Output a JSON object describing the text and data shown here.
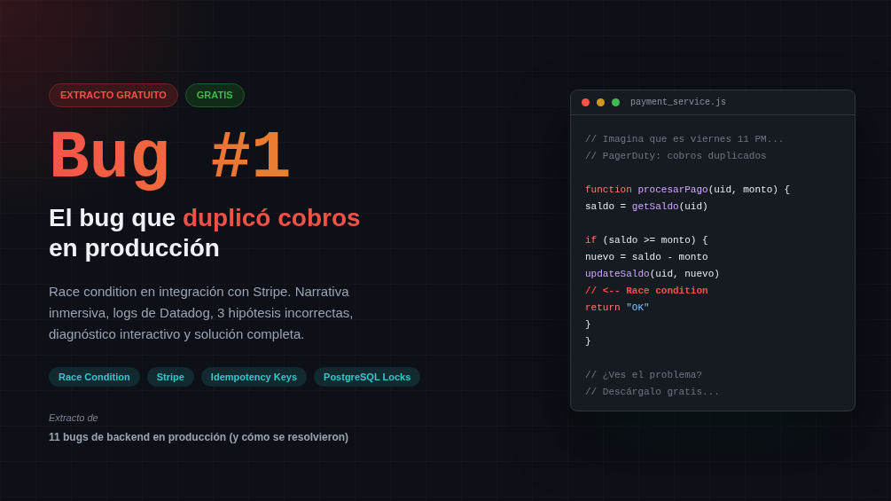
{
  "badges": [
    {
      "label": "EXTRACTO GRATUITO",
      "kind": "red"
    },
    {
      "label": "GRATIS",
      "kind": "green"
    }
  ],
  "title": "Bug #1",
  "headline": {
    "before": "El bug que ",
    "highlight": "duplicó cobros",
    "after": "en producción"
  },
  "description": "Race condition en integración con Stripe. Narrativa inmersiva, logs de Datadog, 3 hipótesis incorrectas, diagnóstico interactivo y solución completa.",
  "tags": [
    "Race Condition",
    "Stripe",
    "Idempotency Keys",
    "PostgreSQL Locks"
  ],
  "source": {
    "label": "Extracto de",
    "book": "11 bugs de backend en producción (y cómo se resolvieron)"
  },
  "editor": {
    "filename": "payment_service.js",
    "lines": [
      {
        "kind": "code",
        "tokens": [
          {
            "kind": "comment",
            "text": "// Imagina que es viernes 11 PM..."
          }
        ]
      },
      {
        "kind": "code",
        "tokens": [
          {
            "kind": "comment",
            "text": "// PagerDuty: cobros duplicados"
          }
        ]
      },
      {
        "kind": "blank"
      },
      {
        "kind": "code",
        "tokens": [
          {
            "kind": "keyword",
            "text": "function "
          },
          {
            "kind": "function",
            "text": "procesarPago"
          },
          {
            "kind": "plain",
            "text": "(uid, monto) {"
          }
        ]
      },
      {
        "kind": "code",
        "tokens": [
          {
            "kind": "plain",
            "text": "saldo = "
          },
          {
            "kind": "function",
            "text": "getSaldo"
          },
          {
            "kind": "plain",
            "text": "(uid)"
          }
        ]
      },
      {
        "kind": "blank"
      },
      {
        "kind": "code",
        "tokens": [
          {
            "kind": "keyword",
            "text": "if"
          },
          {
            "kind": "plain",
            "text": " (saldo >= monto) {"
          }
        ]
      },
      {
        "kind": "code",
        "tokens": [
          {
            "kind": "plain",
            "text": "nuevo = saldo - monto"
          }
        ]
      },
      {
        "kind": "code",
        "tokens": [
          {
            "kind": "function",
            "text": "updateSaldo"
          },
          {
            "kind": "plain",
            "text": "(uid, nuevo)"
          }
        ]
      },
      {
        "kind": "code",
        "tokens": [
          {
            "kind": "alert",
            "text": "// <-- Race condition"
          }
        ]
      },
      {
        "kind": "code",
        "tokens": [
          {
            "kind": "keyword",
            "text": "return "
          },
          {
            "kind": "string",
            "text": "\"OK\""
          }
        ]
      },
      {
        "kind": "code",
        "tokens": [
          {
            "kind": "plain",
            "text": "}"
          }
        ]
      },
      {
        "kind": "code",
        "tokens": [
          {
            "kind": "plain",
            "text": "}"
          }
        ]
      },
      {
        "kind": "blank"
      },
      {
        "kind": "code",
        "tokens": [
          {
            "kind": "comment",
            "text": "// ¿Ves el problema?"
          }
        ]
      },
      {
        "kind": "code",
        "tokens": [
          {
            "kind": "comment",
            "text": "// Descárgalo gratis..."
          }
        ]
      }
    ]
  }
}
